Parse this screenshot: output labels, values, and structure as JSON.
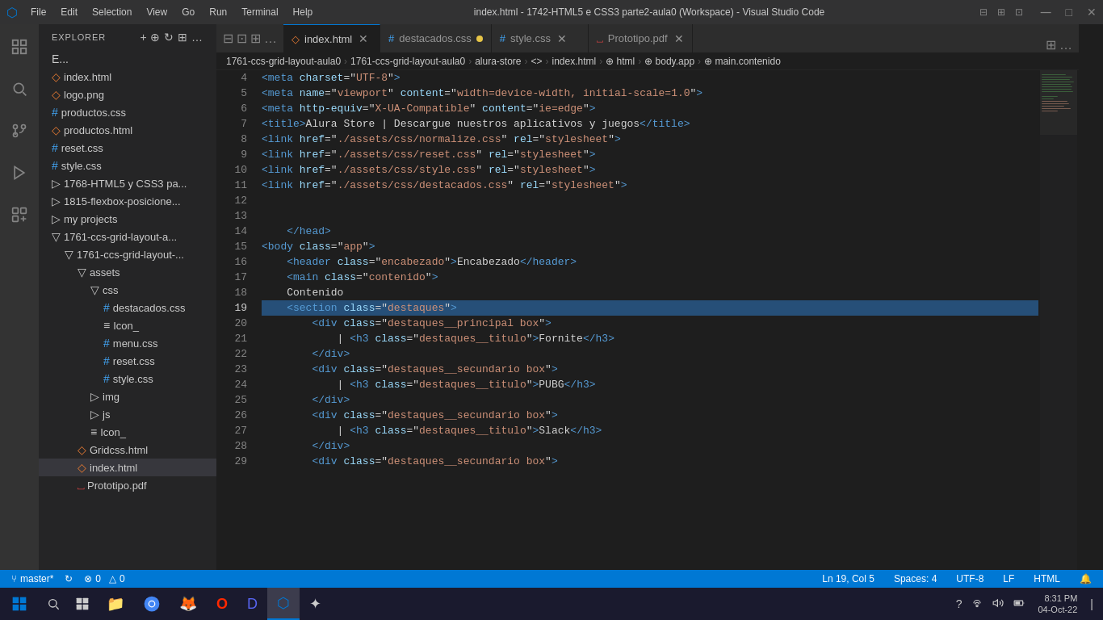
{
  "titlebar": {
    "title": "index.html - 1742-HTML5 e CSS3 parte2-aula0 (Workspace) - Visual Studio Code",
    "menu_items": [
      "File",
      "Edit",
      "Selection",
      "View",
      "Go",
      "Run",
      "Terminal",
      "Help"
    ]
  },
  "tabs": [
    {
      "id": "index-html",
      "label": "index.html",
      "icon": "◇",
      "active": true,
      "modified": false
    },
    {
      "id": "destacados-css",
      "label": "destacados.css",
      "icon": "#",
      "active": false,
      "modified": true
    },
    {
      "id": "style-css",
      "label": "style.css",
      "icon": "#",
      "active": false,
      "modified": false
    },
    {
      "id": "prototipo-pdf",
      "label": "Prototipo.pdf",
      "icon": "⎵",
      "active": false,
      "modified": false
    }
  ],
  "breadcrumb": {
    "parts": [
      "1761-ccs-grid-layout-aula0",
      "1761-ccs-grid-layout-aula0",
      "alura-store",
      "<>",
      "index.html",
      "⊕ html",
      "⊕ body.app",
      "⊕ main.contenido"
    ]
  },
  "sidebar": {
    "title": "EXPLORER",
    "items": [
      {
        "indent": 0,
        "label": "E...",
        "icon": "≡",
        "type": "section"
      },
      {
        "indent": 1,
        "label": "index.html",
        "icon": "◇",
        "color": "#e37933"
      },
      {
        "indent": 1,
        "label": "logo.png",
        "icon": "◇",
        "color": "#e37933"
      },
      {
        "indent": 1,
        "label": "productos.css",
        "icon": "#",
        "color": "#42a5f5"
      },
      {
        "indent": 1,
        "label": "productos.html",
        "icon": "◇",
        "color": "#e37933"
      },
      {
        "indent": 1,
        "label": "reset.css",
        "icon": "#",
        "color": "#42a5f5"
      },
      {
        "indent": 1,
        "label": "style.css",
        "icon": "#",
        "color": "#42a5f5"
      },
      {
        "indent": 1,
        "label": "1768-HTML5 y CSS3 pa...",
        "icon": "▷",
        "color": "#cccccc"
      },
      {
        "indent": 1,
        "label": "1815-flexbox-posicione...",
        "icon": "▷",
        "color": "#cccccc"
      },
      {
        "indent": 1,
        "label": "my projects",
        "icon": "▷",
        "color": "#cccccc"
      },
      {
        "indent": 1,
        "label": "1761-ccs-grid-layout-a...",
        "icon": "▽",
        "color": "#cccccc"
      },
      {
        "indent": 2,
        "label": "1761-ccs-grid-layout-...",
        "icon": "▽",
        "color": "#cccccc"
      },
      {
        "indent": 3,
        "label": "assets",
        "icon": "▽",
        "color": "#cccccc"
      },
      {
        "indent": 4,
        "label": "css",
        "icon": "▽",
        "color": "#cccccc"
      },
      {
        "indent": 5,
        "label": "destacados.css",
        "icon": "#",
        "color": "#42a5f5"
      },
      {
        "indent": 5,
        "label": "Icon_",
        "icon": "≡",
        "color": "#cccccc"
      },
      {
        "indent": 5,
        "label": "menu.css",
        "icon": "#",
        "color": "#42a5f5"
      },
      {
        "indent": 5,
        "label": "reset.css",
        "icon": "#",
        "color": "#42a5f5"
      },
      {
        "indent": 5,
        "label": "style.css",
        "icon": "#",
        "color": "#42a5f5"
      },
      {
        "indent": 4,
        "label": "img",
        "icon": "▷",
        "color": "#cccccc"
      },
      {
        "indent": 4,
        "label": "js",
        "icon": "▷",
        "color": "#cccccc"
      },
      {
        "indent": 4,
        "label": "Icon_",
        "icon": "≡",
        "color": "#cccccc"
      },
      {
        "indent": 3,
        "label": "Gridcss.html",
        "icon": "◇",
        "color": "#e37933"
      },
      {
        "indent": 3,
        "label": "index.html",
        "icon": "◇",
        "color": "#e37933"
      },
      {
        "indent": 3,
        "label": "Prototipo.pdf",
        "icon": "⎵",
        "color": "#f44747"
      }
    ]
  },
  "editor": {
    "active_line": 19,
    "lines": [
      {
        "num": 4,
        "content": [
          {
            "t": "t-tag",
            "v": "    <meta "
          },
          {
            "t": "t-attr",
            "v": "charset"
          },
          {
            "t": "t-white",
            "v": "="
          },
          {
            "t": "t-val",
            "v": "\"UTF-8\""
          },
          {
            "t": "t-tag",
            "v": ">"
          }
        ]
      },
      {
        "num": 5,
        "content": [
          {
            "t": "t-tag",
            "v": "    <meta "
          },
          {
            "t": "t-attr",
            "v": "name"
          },
          {
            "t": "t-white",
            "v": "="
          },
          {
            "t": "t-val",
            "v": "\"viewport\""
          },
          {
            "t": "t-white",
            "v": " "
          },
          {
            "t": "t-attr",
            "v": "content"
          },
          {
            "t": "t-white",
            "v": "="
          },
          {
            "t": "t-val",
            "v": "\"width=device-width, initial-scale=1.0\""
          },
          {
            "t": "t-tag",
            "v": ">"
          }
        ]
      },
      {
        "num": 6,
        "content": [
          {
            "t": "t-tag",
            "v": "    <meta "
          },
          {
            "t": "t-attr",
            "v": "http-equiv"
          },
          {
            "t": "t-white",
            "v": "="
          },
          {
            "t": "t-val",
            "v": "\"X-UA-Compatible\""
          },
          {
            "t": "t-white",
            "v": " "
          },
          {
            "t": "t-attr",
            "v": "content"
          },
          {
            "t": "t-white",
            "v": "="
          },
          {
            "t": "t-val",
            "v": "\"ie=edge\""
          },
          {
            "t": "t-tag",
            "v": ">"
          }
        ]
      },
      {
        "num": 7,
        "content": [
          {
            "t": "t-tag",
            "v": "    <title>"
          },
          {
            "t": "t-white",
            "v": "Alura Store | Descargue nuestros aplicativos y juegos"
          },
          {
            "t": "t-tag",
            "v": "</title>"
          }
        ]
      },
      {
        "num": 8,
        "content": [
          {
            "t": "t-tag",
            "v": "    <link "
          },
          {
            "t": "t-attr",
            "v": "href"
          },
          {
            "t": "t-white",
            "v": "="
          },
          {
            "t": "t-val",
            "v": "\"./assets/css/normalize.css\""
          },
          {
            "t": "t-white",
            "v": " "
          },
          {
            "t": "t-attr",
            "v": "rel"
          },
          {
            "t": "t-white",
            "v": "="
          },
          {
            "t": "t-val",
            "v": "\"stylesheet\""
          },
          {
            "t": "t-tag",
            "v": ">"
          }
        ]
      },
      {
        "num": 9,
        "content": [
          {
            "t": "t-tag",
            "v": "    <link "
          },
          {
            "t": "t-attr",
            "v": "href"
          },
          {
            "t": "t-white",
            "v": "="
          },
          {
            "t": "t-val",
            "v": "\"./assets/css/reset.css\""
          },
          {
            "t": "t-white",
            "v": " "
          },
          {
            "t": "t-attr",
            "v": "rel"
          },
          {
            "t": "t-white",
            "v": "="
          },
          {
            "t": "t-val",
            "v": "\"stylesheet\""
          },
          {
            "t": "t-tag",
            "v": ">"
          }
        ]
      },
      {
        "num": 10,
        "content": [
          {
            "t": "t-tag",
            "v": "    <link "
          },
          {
            "t": "t-attr",
            "v": "href"
          },
          {
            "t": "t-white",
            "v": "="
          },
          {
            "t": "t-val",
            "v": "\"./assets/css/style.css\""
          },
          {
            "t": "t-white",
            "v": " "
          },
          {
            "t": "t-attr",
            "v": "rel"
          },
          {
            "t": "t-white",
            "v": "="
          },
          {
            "t": "t-val",
            "v": "\"stylesheet\""
          },
          {
            "t": "t-tag",
            "v": ">"
          }
        ]
      },
      {
        "num": 11,
        "content": [
          {
            "t": "t-tag",
            "v": "    <link "
          },
          {
            "t": "t-attr",
            "v": "href"
          },
          {
            "t": "t-white",
            "v": "="
          },
          {
            "t": "t-val",
            "v": "\"./assets/css/destacados.css\""
          },
          {
            "t": "t-white",
            "v": " "
          },
          {
            "t": "t-attr",
            "v": "rel"
          },
          {
            "t": "t-white",
            "v": "="
          },
          {
            "t": "t-val",
            "v": "\"stylesheet\""
          },
          {
            "t": "t-tag",
            "v": ">"
          }
        ]
      },
      {
        "num": 12,
        "content": []
      },
      {
        "num": 13,
        "content": []
      },
      {
        "num": 14,
        "content": [
          {
            "t": "t-tag",
            "v": "    </head>"
          }
        ]
      },
      {
        "num": 15,
        "content": [
          {
            "t": "t-tag",
            "v": "<body "
          },
          {
            "t": "t-attr",
            "v": "class"
          },
          {
            "t": "t-white",
            "v": "="
          },
          {
            "t": "t-val",
            "v": "\"app\""
          },
          {
            "t": "t-tag",
            "v": ">"
          }
        ]
      },
      {
        "num": 16,
        "content": [
          {
            "t": "t-tag",
            "v": "    <header "
          },
          {
            "t": "t-attr",
            "v": "class"
          },
          {
            "t": "t-white",
            "v": "="
          },
          {
            "t": "t-val",
            "v": "\"encabezado\""
          },
          {
            "t": "t-tag",
            "v": ">"
          },
          {
            "t": "t-white",
            "v": "Encabezado"
          },
          {
            "t": "t-tag",
            "v": "</header>"
          }
        ]
      },
      {
        "num": 17,
        "content": [
          {
            "t": "t-tag",
            "v": "    <main "
          },
          {
            "t": "t-attr",
            "v": "class"
          },
          {
            "t": "t-white",
            "v": "="
          },
          {
            "t": "t-val",
            "v": "\"contenido\""
          },
          {
            "t": "t-tag",
            "v": ">"
          }
        ]
      },
      {
        "num": 18,
        "content": [
          {
            "t": "t-white",
            "v": "    Contenido"
          }
        ]
      },
      {
        "num": 19,
        "content": [
          {
            "t": "t-tag",
            "v": "    <section "
          },
          {
            "t": "t-attr",
            "v": "class"
          },
          {
            "t": "t-white",
            "v": "="
          },
          {
            "t": "t-val",
            "v": "\"destaques\""
          },
          {
            "t": "t-tag",
            "v": ">"
          }
        ],
        "active": true
      },
      {
        "num": 20,
        "content": [
          {
            "t": "t-tag",
            "v": "        <div "
          },
          {
            "t": "t-attr",
            "v": "class"
          },
          {
            "t": "t-white",
            "v": "="
          },
          {
            "t": "t-val",
            "v": "\"destaques__principal box\""
          },
          {
            "t": "t-tag",
            "v": ">"
          }
        ]
      },
      {
        "num": 21,
        "content": [
          {
            "t": "t-tag",
            "v": "            | <h3 "
          },
          {
            "t": "t-attr",
            "v": "class"
          },
          {
            "t": "t-white",
            "v": "="
          },
          {
            "t": "t-val",
            "v": "\"destaques__titulo\""
          },
          {
            "t": "t-tag",
            "v": ">"
          },
          {
            "t": "t-white",
            "v": "Fornite"
          },
          {
            "t": "t-tag",
            "v": "</h3>"
          }
        ]
      },
      {
        "num": 22,
        "content": [
          {
            "t": "t-tag",
            "v": "        </div>"
          }
        ]
      },
      {
        "num": 23,
        "content": [
          {
            "t": "t-tag",
            "v": "        <div "
          },
          {
            "t": "t-attr",
            "v": "class"
          },
          {
            "t": "t-white",
            "v": "="
          },
          {
            "t": "t-val",
            "v": "\"destaques__secundario box\""
          },
          {
            "t": "t-tag",
            "v": ">"
          }
        ]
      },
      {
        "num": 24,
        "content": [
          {
            "t": "t-tag",
            "v": "            | <h3 "
          },
          {
            "t": "t-attr",
            "v": "class"
          },
          {
            "t": "t-white",
            "v": "="
          },
          {
            "t": "t-val",
            "v": "\"destaques__titulo\""
          },
          {
            "t": "t-tag",
            "v": ">"
          },
          {
            "t": "t-white",
            "v": "PUBG"
          },
          {
            "t": "t-tag",
            "v": "</h3>"
          }
        ]
      },
      {
        "num": 25,
        "content": [
          {
            "t": "t-tag",
            "v": "        </div>"
          }
        ]
      },
      {
        "num": 26,
        "content": [
          {
            "t": "t-tag",
            "v": "        <div "
          },
          {
            "t": "t-attr",
            "v": "class"
          },
          {
            "t": "t-white",
            "v": "="
          },
          {
            "t": "t-val",
            "v": "\"destaques__secundario box\""
          },
          {
            "t": "t-tag",
            "v": ">"
          }
        ]
      },
      {
        "num": 27,
        "content": [
          {
            "t": "t-tag",
            "v": "            | <h3 "
          },
          {
            "t": "t-attr",
            "v": "class"
          },
          {
            "t": "t-white",
            "v": "="
          },
          {
            "t": "t-val",
            "v": "\"destaques__titulo\""
          },
          {
            "t": "t-tag",
            "v": ">"
          },
          {
            "t": "t-white",
            "v": "Slack"
          },
          {
            "t": "t-tag",
            "v": "</h3>"
          }
        ]
      },
      {
        "num": 28,
        "content": [
          {
            "t": "t-tag",
            "v": "        </div>"
          }
        ]
      },
      {
        "num": 29,
        "content": [
          {
            "t": "t-tag",
            "v": "        <div "
          },
          {
            "t": "t-attr",
            "v": "class"
          },
          {
            "t": "t-white",
            "v": "="
          },
          {
            "t": "t-val",
            "v": "\"destaques__secundario box\""
          },
          {
            "t": "t-tag",
            "v": ">"
          }
        ]
      }
    ]
  },
  "status_bar": {
    "branch": "master*",
    "sync": "⟳",
    "errors": "⊗ 0",
    "warnings": "△ 0",
    "cursor": "Ln 19, Col 5",
    "spaces": "Spaces: 4",
    "encoding": "UTF-8",
    "line_ending": "LF",
    "language": "HTML"
  },
  "taskbar": {
    "time": "8:31 PM",
    "date": "04-Oct-22",
    "apps": [
      {
        "label": "File Explorer",
        "icon": "📁",
        "active": false
      },
      {
        "label": "Chrome",
        "icon": "●",
        "active": false
      },
      {
        "label": "Firefox",
        "icon": "🦊",
        "active": false
      },
      {
        "label": "Opera",
        "icon": "O",
        "active": false
      },
      {
        "label": "Discord",
        "icon": "D",
        "active": false
      },
      {
        "label": "VS Code",
        "icon": "◇",
        "active": true
      },
      {
        "label": "App",
        "icon": "✦",
        "active": false
      }
    ]
  }
}
